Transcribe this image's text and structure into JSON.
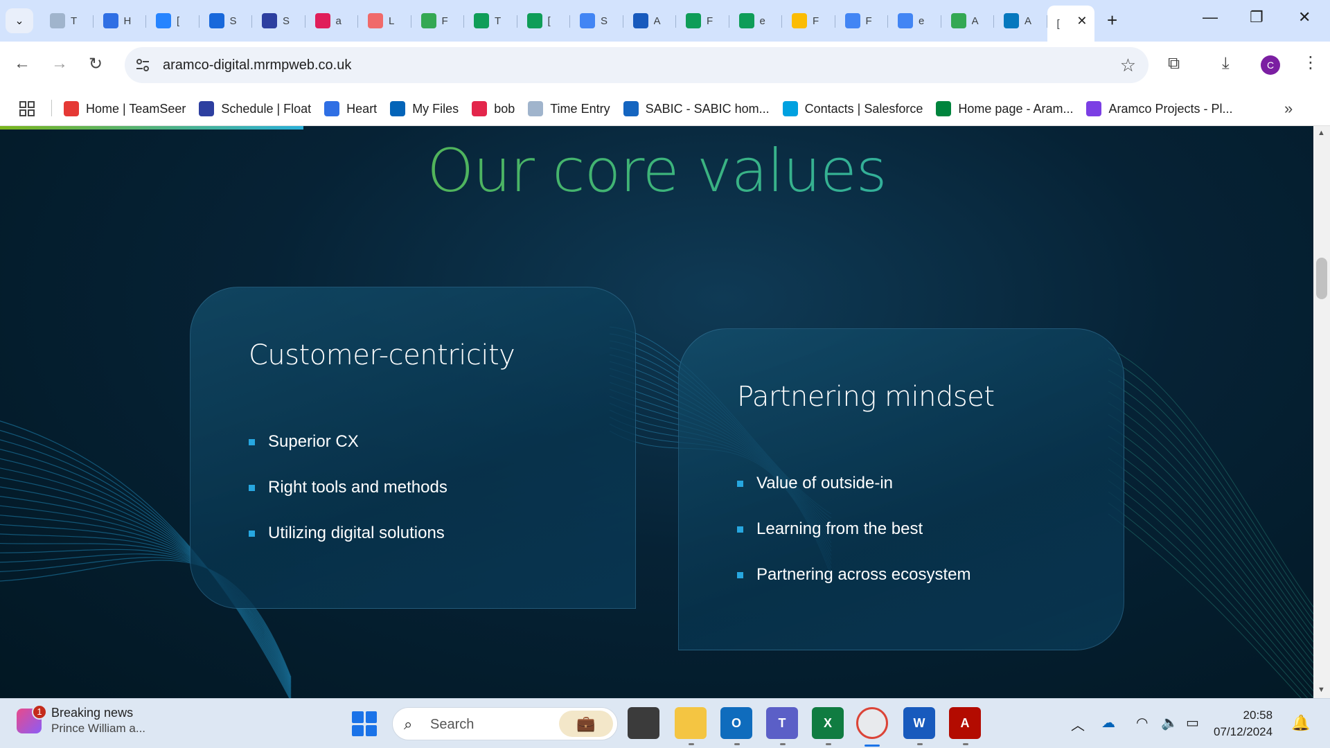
{
  "tabs": [
    {
      "label": "T",
      "icon": "time-entry-icon",
      "color": "#a0b4cc"
    },
    {
      "label": "H",
      "icon": "heart-icon",
      "color": "#2f6fe4"
    },
    {
      "label": "[",
      "icon": "jira-icon",
      "color": "#2684ff"
    },
    {
      "label": "S",
      "icon": "confluence-icon",
      "color": "#1868db"
    },
    {
      "label": "S",
      "icon": "float-icon",
      "color": "#2d3fa0"
    },
    {
      "label": "a",
      "icon": "slack-icon",
      "color": "#e01e5a"
    },
    {
      "label": "L",
      "icon": "asana-icon",
      "color": "#f06a6a"
    },
    {
      "label": "F",
      "icon": "google-drive-icon",
      "color": "#34a853"
    },
    {
      "label": "T",
      "icon": "google-sheets-icon",
      "color": "#0f9d58"
    },
    {
      "label": "[",
      "icon": "google-sheets-icon",
      "color": "#0f9d58"
    },
    {
      "label": "S",
      "icon": "google-docs-icon",
      "color": "#4285f4"
    },
    {
      "label": "A",
      "icon": "word-icon",
      "color": "#185abd"
    },
    {
      "label": "F",
      "icon": "google-sheets-icon",
      "color": "#0f9d58"
    },
    {
      "label": "e",
      "icon": "google-sheets-icon",
      "color": "#0f9d58"
    },
    {
      "label": "F",
      "icon": "google-drive-icon",
      "color": "#fbbc04"
    },
    {
      "label": "F",
      "icon": "google-docs-icon",
      "color": "#4285f4"
    },
    {
      "label": "e",
      "icon": "google-docs-icon",
      "color": "#4285f4"
    },
    {
      "label": "A",
      "icon": "google-drive-icon",
      "color": "#34a853"
    },
    {
      "label": "A",
      "icon": "drupal-icon",
      "color": "#0678be"
    }
  ],
  "active_tab": {
    "label": "[",
    "close": "✕"
  },
  "toolbar": {
    "url": "aramco-digital.mrmpweb.co.uk",
    "profile_initial": "C"
  },
  "bookmarks": [
    {
      "label": "Home | TeamSeer",
      "icon": "teamseer-icon",
      "color": "#e53935"
    },
    {
      "label": "Schedule | Float",
      "icon": "float-icon",
      "color": "#2d3fa0"
    },
    {
      "label": "Heart",
      "icon": "heart-icon",
      "color": "#2f6fe4"
    },
    {
      "label": "My Files",
      "icon": "onedrive-icon",
      "color": "#0364b8"
    },
    {
      "label": "bob",
      "icon": "bob-icon",
      "color": "#e3264b"
    },
    {
      "label": "Time Entry",
      "icon": "time-entry-icon",
      "color": "#a0b4cc"
    },
    {
      "label": "SABIC - SABIC hom...",
      "icon": "sabic-icon",
      "color": "#1565c0"
    },
    {
      "label": "Contacts | Salesforce",
      "icon": "salesforce-icon",
      "color": "#00a1e0"
    },
    {
      "label": "Home page - Aram...",
      "icon": "aramco-icon",
      "color": "#00843d"
    },
    {
      "label": "Aramco Projects - Pl...",
      "icon": "planner-icon",
      "color": "#7b3fe4"
    }
  ],
  "page": {
    "title": "Our core values",
    "cards": [
      {
        "title": "Customer-centricity",
        "items": [
          "Superior CX",
          "Right tools and methods",
          "Utilizing digital solutions"
        ]
      },
      {
        "title": "Partnering mindset",
        "items": [
          "Value of outside-in",
          "Learning from the best",
          "Partnering across ecosystem"
        ]
      }
    ],
    "accent_color": "#27a7e0"
  },
  "taskbar": {
    "news_title": "Breaking news",
    "news_subtitle": "Prince William a...",
    "news_badge": "1",
    "search_placeholder": "Search",
    "apps": [
      {
        "name": "task-view",
        "label": ""
      },
      {
        "name": "file-explorer",
        "label": ""
      },
      {
        "name": "outlook",
        "label": "O"
      },
      {
        "name": "teams",
        "label": "T"
      },
      {
        "name": "excel",
        "label": "X"
      },
      {
        "name": "chrome",
        "label": ""
      },
      {
        "name": "word",
        "label": "W"
      },
      {
        "name": "acrobat",
        "label": "A"
      }
    ],
    "time": "20:58",
    "date": "07/12/2024"
  }
}
